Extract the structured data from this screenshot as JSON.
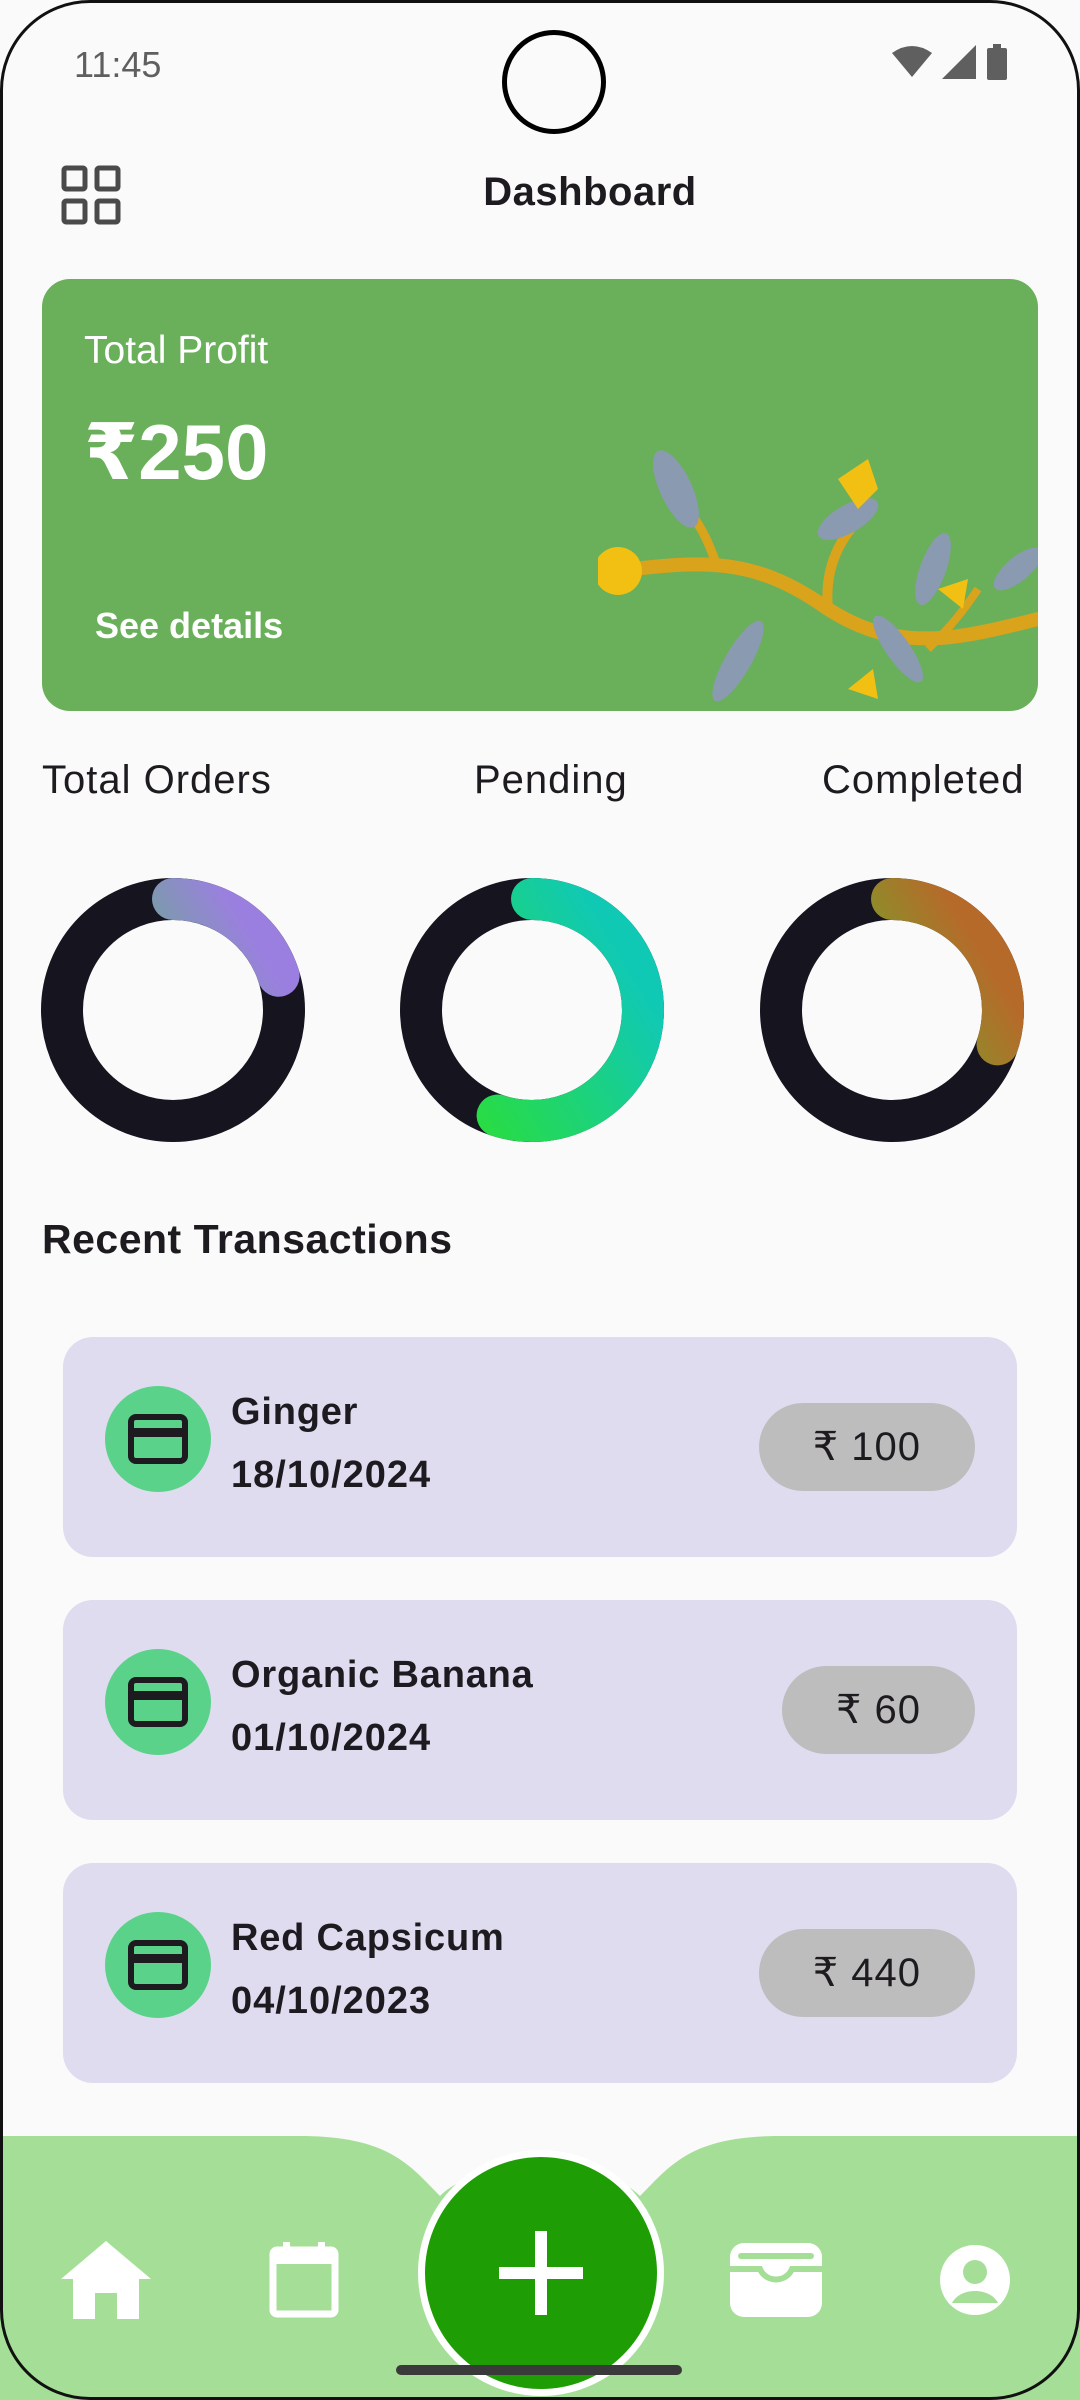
{
  "status_bar": {
    "time": "11:45",
    "icons": [
      "wifi-icon",
      "signal-icon",
      "battery-icon"
    ]
  },
  "header": {
    "title": "Dashboard",
    "menu_icon": "grid-icon"
  },
  "profit_card": {
    "label": "Total Profit",
    "amount": "₹250",
    "link": "See details",
    "background": "#6ab05a"
  },
  "stats": [
    {
      "label": "Total Orders",
      "progress": 0.2,
      "colors": [
        "#2ee02a",
        "#9b7fe0"
      ]
    },
    {
      "label": "Pending",
      "progress": 0.55,
      "colors": [
        "#2ee02a",
        "#10c9b4"
      ]
    },
    {
      "label": "Completed",
      "progress": 0.3,
      "colors": [
        "#2ee02a",
        "#b66a2a"
      ]
    }
  ],
  "recent": {
    "title": "Recent Transactions",
    "items": [
      {
        "name": "Ginger",
        "date": "18/10/2024",
        "amount": "₹ 100",
        "icon": "credit-card-icon"
      },
      {
        "name": "Organic Banana",
        "date": "01/10/2024",
        "amount": "₹ 60",
        "icon": "credit-card-icon"
      },
      {
        "name": "Red Capsicum",
        "date": "04/10/2023",
        "amount": "₹ 440",
        "icon": "credit-card-icon"
      }
    ]
  },
  "bottom_nav": {
    "items": [
      "home-icon",
      "calendar-icon",
      "add-icon",
      "wallet-icon",
      "account-icon"
    ],
    "background": "#a5df97",
    "fab_color": "#1e9e04"
  }
}
